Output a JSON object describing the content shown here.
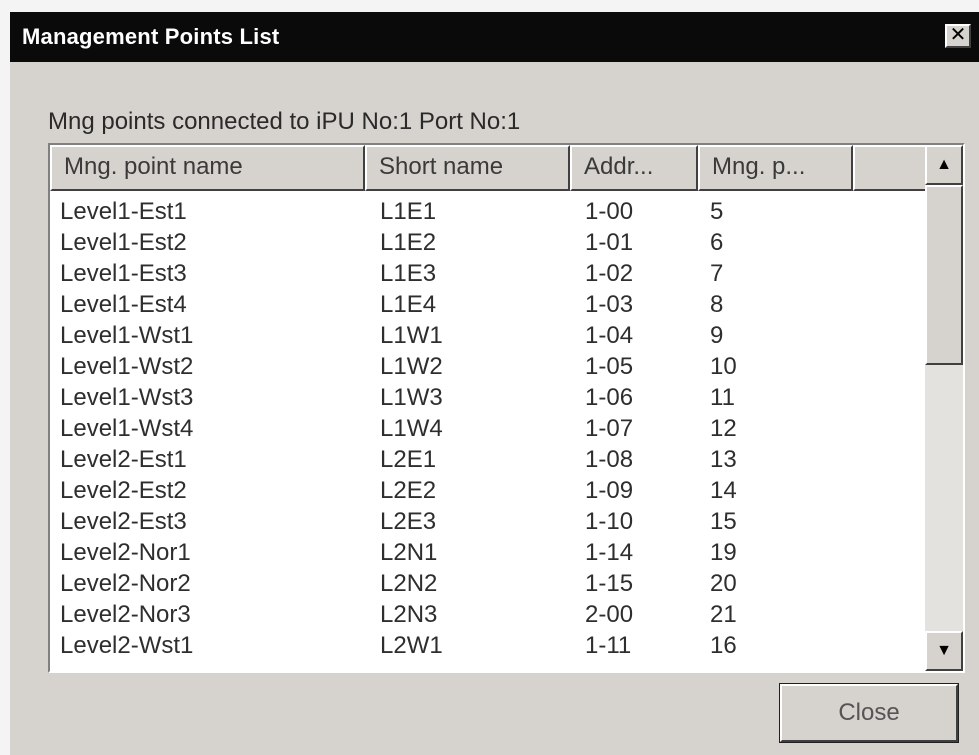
{
  "window": {
    "title": "Management Points List",
    "close_glyph": "✕"
  },
  "subtitle": "Mng points connected to iPU No:1 Port No:1",
  "table": {
    "columns": [
      "Mng. point name",
      "Short name",
      "Addr...",
      "Mng. p..."
    ],
    "rows": [
      [
        "Level1-Est1",
        "L1E1",
        "1-00",
        "5"
      ],
      [
        "Level1-Est2",
        "L1E2",
        "1-01",
        "6"
      ],
      [
        "Level1-Est3",
        "L1E3",
        "1-02",
        "7"
      ],
      [
        "Level1-Est4",
        "L1E4",
        "1-03",
        "8"
      ],
      [
        "Level1-Wst1",
        "L1W1",
        "1-04",
        "9"
      ],
      [
        "Level1-Wst2",
        "L1W2",
        "1-05",
        "10"
      ],
      [
        "Level1-Wst3",
        "L1W3",
        "1-06",
        "11"
      ],
      [
        "Level1-Wst4",
        "L1W4",
        "1-07",
        "12"
      ],
      [
        "Level2-Est1",
        "L2E1",
        "1-08",
        "13"
      ],
      [
        "Level2-Est2",
        "L2E2",
        "1-09",
        "14"
      ],
      [
        "Level2-Est3",
        "L2E3",
        "1-10",
        "15"
      ],
      [
        "Level2-Nor1",
        "L2N1",
        "1-14",
        "19"
      ],
      [
        "Level2-Nor2",
        "L2N2",
        "1-15",
        "20"
      ],
      [
        "Level2-Nor3",
        "L2N3",
        "2-00",
        "21"
      ],
      [
        "Level2-Wst1",
        "L2W1",
        "1-11",
        "16"
      ]
    ]
  },
  "scrollbar": {
    "up_glyph": "▲",
    "down_glyph": "▼"
  },
  "buttons": {
    "close_label": "Close"
  }
}
